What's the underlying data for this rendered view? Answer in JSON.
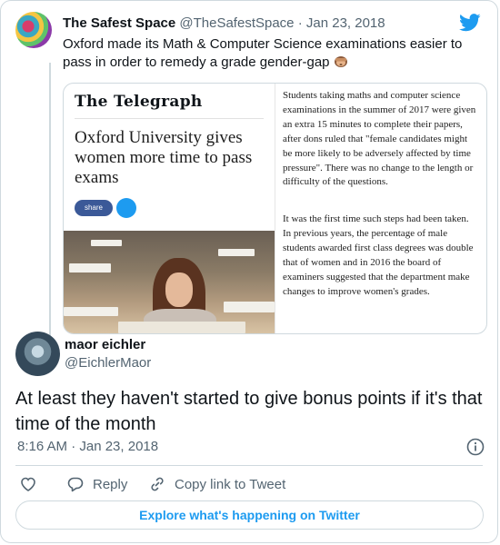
{
  "quoted_tweet": {
    "author_name": "The Safest Space",
    "handle": "@TheSafestSpace",
    "separator": "·",
    "date": "Jan 23, 2018",
    "text": "Oxford made its Math & Computer Science examinations easier to pass in order to remedy a grade gender-gap",
    "emoji_icon": "see-no-evil-monkey",
    "article": {
      "masthead": "The Telegraph",
      "headline": "Oxford University gives women more time to pass exams",
      "share_label": "share",
      "paragraph_1": "Students taking maths and computer science examinations in the summer of 2017 were given an extra 15 minutes to complete their papers, after dons ruled that \"female candidates might be more likely to be adversely affected by time pressure\". There was no change to the length or difficulty of the questions.",
      "paragraph_2": "It was the first time such steps had been taken. In previous years, the percentage of male students awarded first class degrees was double that of women and in 2016 the board of examiners suggested that the department make changes to improve women's grades."
    }
  },
  "reply": {
    "author_name": "maor eichler",
    "handle": "@EichlerMaor",
    "text": "At least they haven't started to give bonus points if it's that time of the month",
    "timestamp": "8:16 AM · Jan 23, 2018"
  },
  "actions": {
    "reply_label": "Reply",
    "copy_link_label": "Copy link to Tweet"
  },
  "explore_label": "Explore what's happening on Twitter",
  "colors": {
    "twitter_blue": "#1d9bf0",
    "muted_text": "#536471",
    "border": "#cfd9de",
    "facebook_blue": "#3b5998"
  }
}
